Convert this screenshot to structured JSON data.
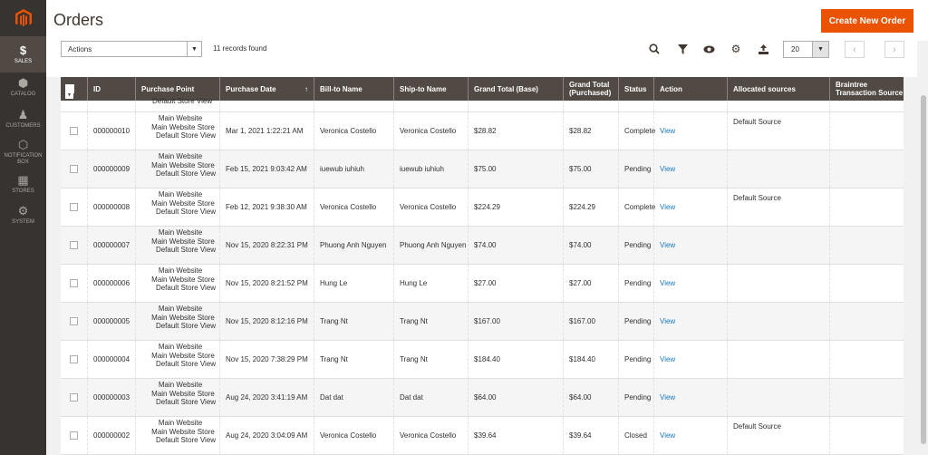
{
  "sidebar": {
    "items": [
      {
        "label": "SALES",
        "icon": "dollar-icon",
        "glyph": "$",
        "active": true
      },
      {
        "label": "CATALOG",
        "icon": "cube-icon",
        "glyph": "⬢",
        "active": false
      },
      {
        "label": "CUSTOMERS",
        "icon": "person-icon",
        "glyph": "♟",
        "active": false
      },
      {
        "label": "NOTIFICATION BOX",
        "icon": "hexagon-icon",
        "glyph": "⬡",
        "active": false
      },
      {
        "label": "STORES",
        "icon": "store-icon",
        "glyph": "▦",
        "active": false
      },
      {
        "label": "SYSTEM",
        "icon": "gear-icon",
        "glyph": "⚙",
        "active": false
      }
    ]
  },
  "header": {
    "title": "Orders",
    "create_button": "Create New Order"
  },
  "toolbar": {
    "actions_label": "Actions",
    "records_found": "11 records found",
    "page_size": "20"
  },
  "grid": {
    "columns": [
      "ID",
      "Purchase Point",
      "Purchase Date",
      "Bill-to Name",
      "Ship-to Name",
      "Grand Total (Base)",
      "Grand Total (Purchased)",
      "Status",
      "Action",
      "Allocated sources",
      "Braintree Transaction Source"
    ],
    "sort_indicator": "↑",
    "partial_row": {
      "pp3": "Default Store View"
    },
    "rows": [
      {
        "id": "000000010",
        "pp1": "Main Website",
        "pp2": "Main Website Store",
        "pp3": "Default Store View",
        "date": "Mar 1, 2021 1:22:21 AM",
        "bill": "Veronica Costello",
        "ship": "Veronica Costello",
        "base": "$28.82",
        "purchased": "$28.82",
        "status": "Complete",
        "action": "View",
        "source": "Default Source",
        "braintree": ""
      },
      {
        "id": "000000009",
        "pp1": "Main Website",
        "pp2": "Main Website Store",
        "pp3": "Default Store View",
        "date": "Feb 15, 2021 9:03:42 AM",
        "bill": "iuewub iuhiuh",
        "ship": "iuewub iuhiuh",
        "base": "$75.00",
        "purchased": "$75.00",
        "status": "Pending",
        "action": "View",
        "source": "",
        "braintree": ""
      },
      {
        "id": "000000008",
        "pp1": "Main Website",
        "pp2": "Main Website Store",
        "pp3": "Default Store View",
        "date": "Feb 12, 2021 9:38:30 AM",
        "bill": "Veronica Costello",
        "ship": "Veronica Costello",
        "base": "$224.29",
        "purchased": "$224.29",
        "status": "Complete",
        "action": "View",
        "source": "Default Source",
        "braintree": ""
      },
      {
        "id": "000000007",
        "pp1": "Main Website",
        "pp2": "Main Website Store",
        "pp3": "Default Store View",
        "date": "Nov 15, 2020 8:22:31 PM",
        "bill": "Phuong Anh Nguyen",
        "ship": "Phuong Anh Nguyen",
        "base": "$74.00",
        "purchased": "$74.00",
        "status": "Pending",
        "action": "View",
        "source": "",
        "braintree": ""
      },
      {
        "id": "000000006",
        "pp1": "Main Website",
        "pp2": "Main Website Store",
        "pp3": "Default Store View",
        "date": "Nov 15, 2020 8:21:52 PM",
        "bill": "Hung Le",
        "ship": "Hung Le",
        "base": "$27.00",
        "purchased": "$27.00",
        "status": "Pending",
        "action": "View",
        "source": "",
        "braintree": ""
      },
      {
        "id": "000000005",
        "pp1": "Main Website",
        "pp2": "Main Website Store",
        "pp3": "Default Store View",
        "date": "Nov 15, 2020 8:12:16 PM",
        "bill": "Trang Nt",
        "ship": "Trang Nt",
        "base": "$167.00",
        "purchased": "$167.00",
        "status": "Pending",
        "action": "View",
        "source": "",
        "braintree": ""
      },
      {
        "id": "000000004",
        "pp1": "Main Website",
        "pp2": "Main Website Store",
        "pp3": "Default Store View",
        "date": "Nov 15, 2020 7:38:29 PM",
        "bill": "Trang Nt",
        "ship": "Trang Nt",
        "base": "$184.40",
        "purchased": "$184.40",
        "status": "Pending",
        "action": "View",
        "source": "",
        "braintree": ""
      },
      {
        "id": "000000003",
        "pp1": "Main Website",
        "pp2": "Main Website Store",
        "pp3": "Default Store View",
        "date": "Aug 24, 2020 3:41:19 AM",
        "bill": "Dat dat",
        "ship": "Dat dat",
        "base": "$64.00",
        "purchased": "$64.00",
        "status": "Pending",
        "action": "View",
        "source": "",
        "braintree": ""
      },
      {
        "id": "000000002",
        "pp1": "Main Website",
        "pp2": "Main Website Store",
        "pp3": "Default Store View",
        "date": "Aug 24, 2020 3:04:09 AM",
        "bill": "Veronica Costello",
        "ship": "Veronica Costello",
        "base": "$39.64",
        "purchased": "$39.64",
        "status": "Closed",
        "action": "View",
        "source": "Default Source",
        "braintree": ""
      }
    ]
  },
  "colors": {
    "sidebar_bg": "#373330",
    "grid_header_bg": "#514943",
    "accent": "#eb5202",
    "link": "#1979c3"
  }
}
